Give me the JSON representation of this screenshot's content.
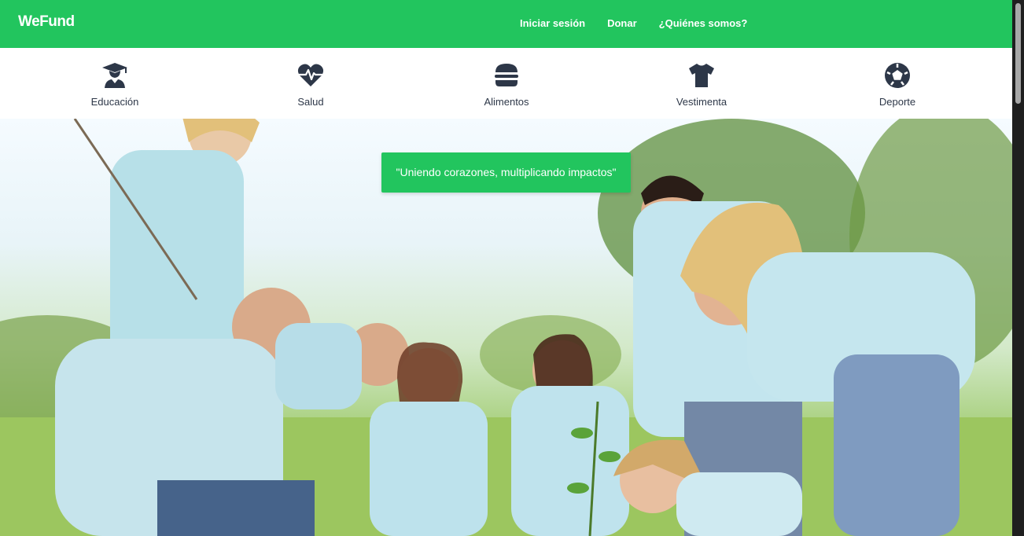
{
  "brand": {
    "name": "WeFund"
  },
  "nav": {
    "links": [
      {
        "label": "Iniciar sesión"
      },
      {
        "label": "Donar"
      },
      {
        "label": "¿Quiénes somos?"
      }
    ]
  },
  "categories": [
    {
      "label": "Educación",
      "icon": "graduate-icon"
    },
    {
      "label": "Salud",
      "icon": "heartbeat-icon"
    },
    {
      "label": "Alimentos",
      "icon": "hamburger-icon"
    },
    {
      "label": "Vestimenta",
      "icon": "tshirt-icon"
    },
    {
      "label": "Deporte",
      "icon": "soccer-ball-icon"
    }
  ],
  "hero": {
    "slogan": "\"Uniendo corazones, multiplicando impactos\"",
    "image": "volunteers-planting-trees-photo"
  },
  "colors": {
    "accent": "#22c55e",
    "icon": "#2d3748"
  }
}
